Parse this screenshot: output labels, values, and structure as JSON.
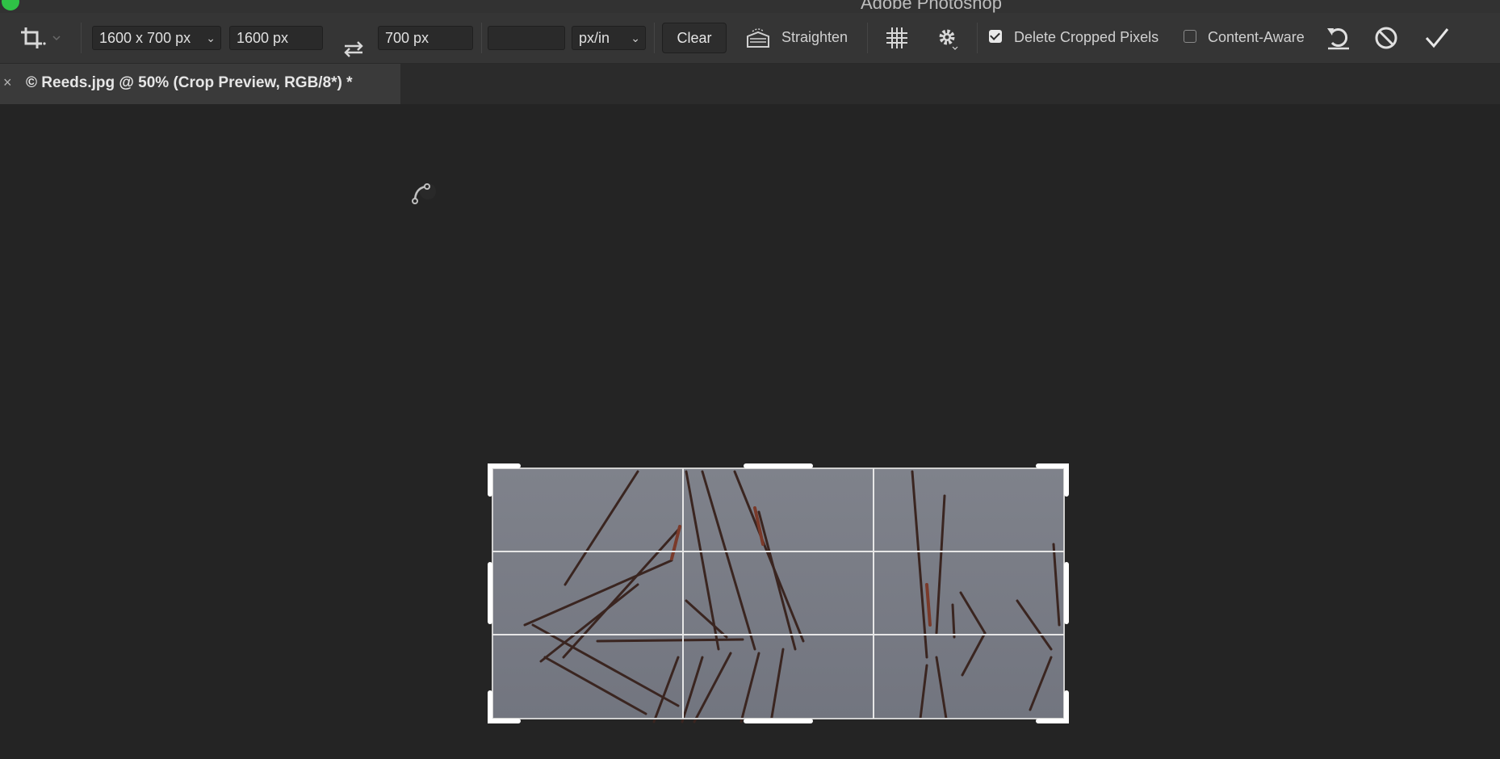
{
  "window": {
    "title": "Adobe Photoshop"
  },
  "options_bar": {
    "tool_icon": "crop-tool-icon",
    "preset_ratio": "1600 x 700 px",
    "width_value": "1600 px",
    "swap_icon": "swap-arrows-icon",
    "height_value": "700 px",
    "resolution_value": "",
    "resolution_unit": "px/in",
    "clear_label": "Clear",
    "straighten_label": "Straighten",
    "overlay_icon": "grid-overlay-icon",
    "settings_icon": "gear-icon",
    "delete_cropped_label": "Delete Cropped Pixels",
    "delete_cropped_checked": true,
    "content_aware_label": "Content-Aware",
    "content_aware_checked": false,
    "reset_icon": "reset-icon",
    "cancel_icon": "cancel-icon",
    "commit_icon": "commit-checkmark-icon"
  },
  "document_tab": {
    "close_label": "×",
    "title": "© Reeds.jpg @ 50% (Crop Preview, RGB/8*) *"
  },
  "colors": {
    "canvas_bg": "#242424",
    "options_bar_bg": "#353535",
    "tab_active_bg": "#3a3a3a",
    "photo_water": "#7b7e88",
    "reed": "#4a2d22"
  }
}
